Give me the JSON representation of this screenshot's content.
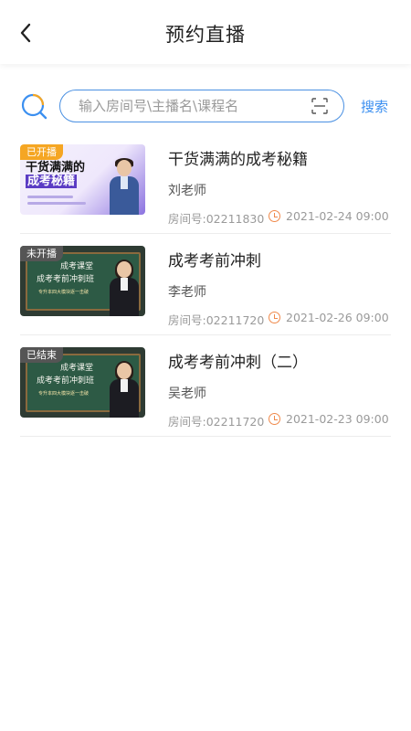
{
  "header": {
    "title": "预约直播",
    "back_icon": "chevron-left-icon"
  },
  "search": {
    "placeholder": "输入房间号\\主播名\\课程名",
    "button_label": "搜索",
    "logo_icon": "search-logo-icon",
    "scan_icon": "scan-icon",
    "accent_color": "#3b8ff0"
  },
  "lives": [
    {
      "status": "已开播",
      "status_color": "#f5a623",
      "title": "干货满满的成考秘籍",
      "teacher": "刘老师",
      "room": "房间号:02211830",
      "time": "2021-02-24  09:00",
      "thumb_text": [
        "干货满满的",
        "成考秘籍"
      ]
    },
    {
      "status": "未开播",
      "status_color": "#555555",
      "title": "成考考前冲刺",
      "teacher": "李老师",
      "room": "房间号:02211720",
      "time": "2021-02-26  09:00",
      "thumb_text": [
        "成考课堂",
        "成考考前冲刺班",
        "专升本四大模块逐一击破"
      ]
    },
    {
      "status": "已结束",
      "status_color": "#555555",
      "title": "成考考前冲刺（二）",
      "teacher": "吴老师",
      "room": "房间号:02211720",
      "time": "2021-02-23  09:00",
      "thumb_text": [
        "成考课堂",
        "成考考前冲刺班",
        "专升本四大模块逐一击破"
      ]
    }
  ]
}
